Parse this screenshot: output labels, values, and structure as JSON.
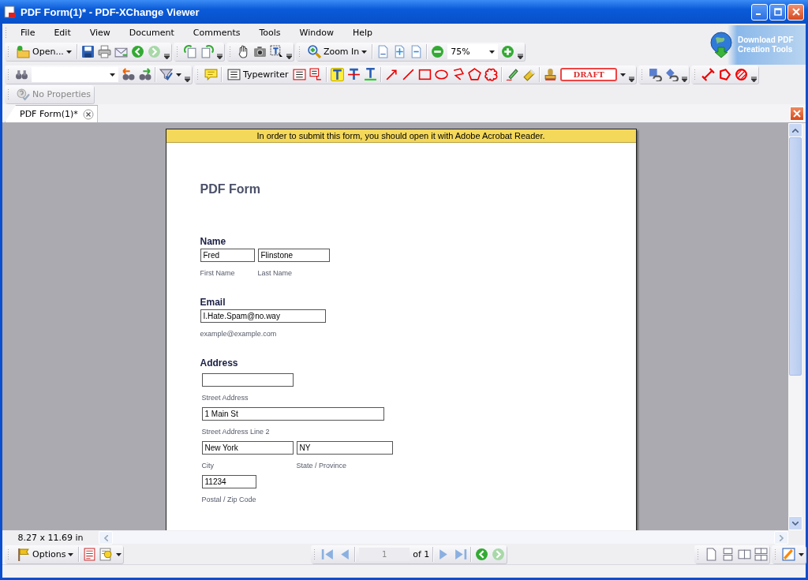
{
  "window": {
    "title": "PDF Form(1)* - PDF-XChange Viewer"
  },
  "menu": [
    "File",
    "Edit",
    "View",
    "Document",
    "Comments",
    "Tools",
    "Window",
    "Help"
  ],
  "promo": {
    "lines": [
      "Download PDF",
      "Creation Tools"
    ]
  },
  "toolbar": {
    "open_label": "Open...",
    "zoom_label": "Zoom In",
    "zoom_value": "75%",
    "typewriter_label": "Typewriter",
    "stamp_label": "DRAFT"
  },
  "properties": {
    "label": "No Properties",
    "disabled": true
  },
  "tabs": [
    {
      "label": "PDF Form(1)*",
      "selected": true
    }
  ],
  "document": {
    "notice": "In order to submit this form, you should open it with Adobe Acrobat Reader.",
    "title": "PDF Form",
    "sections": [
      {
        "heading": "Name",
        "rows": [
          [
            {
              "value": "Fred",
              "label": "First Name"
            },
            {
              "value": "Flinstone",
              "label": "Last Name"
            }
          ]
        ]
      },
      {
        "heading": "Email",
        "rows": [
          [
            {
              "value": "I.Hate.Spam@no.way",
              "label": "example@example.com"
            }
          ]
        ]
      },
      {
        "heading": "Address",
        "rows": [
          [
            {
              "label": "Street Address"
            }
          ],
          [
            {
              "value": "1 Main St",
              "label": "Street Address Line 2"
            }
          ],
          [
            {
              "value": "New York",
              "label": "City"
            },
            {
              "value": "NY",
              "label": "State / Province"
            }
          ],
          [
            {
              "value": "11234",
              "label": "Postal / Zip Code"
            }
          ]
        ]
      }
    ]
  },
  "status": {
    "page_size": "8.27 x 11.69 in"
  },
  "bottom": {
    "options_label": "Options",
    "page": "1",
    "page_count": "of 1"
  }
}
